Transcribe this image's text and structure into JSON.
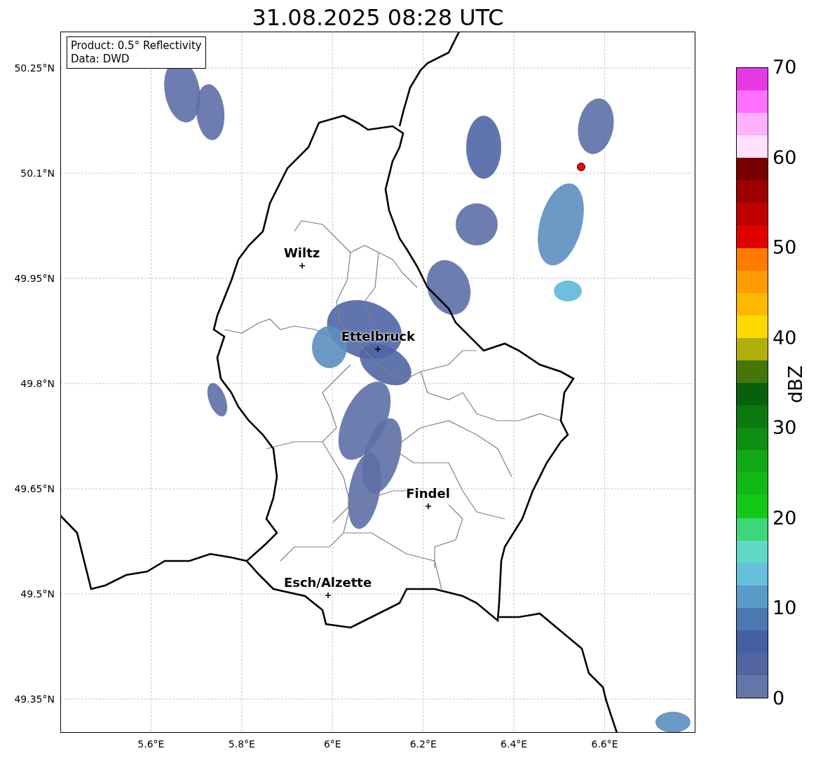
{
  "title": "31.08.2025 08:28 UTC",
  "info_box": [
    "Product: 0.5° Reflectivity",
    "Data: DWD"
  ],
  "map": {
    "lat_ticks": [
      "50.25°N",
      "50.1°N",
      "49.95°N",
      "49.8°N",
      "49.65°N",
      "49.5°N",
      "49.35°N"
    ],
    "lon_ticks": [
      "5.6°E",
      "5.8°E",
      "6°E",
      "6.2°E",
      "6.4°E",
      "6.6°E"
    ],
    "cities": [
      "Wiltz",
      "Ettelbruck",
      "Findel",
      "Esch/Alzette"
    ],
    "radar_site": {
      "color": "#ff0000"
    }
  },
  "colorbar": {
    "label": "dBZ",
    "ticks": [
      "70",
      "60",
      "50",
      "40",
      "30",
      "20",
      "10",
      "0"
    ],
    "segments": [
      {
        "color": "#e63ae6"
      },
      {
        "color": "#ff70ff"
      },
      {
        "color": "#ffb0ff"
      },
      {
        "color": "#ffe0ff"
      },
      {
        "color": "#780000"
      },
      {
        "color": "#9c0000"
      },
      {
        "color": "#c00000"
      },
      {
        "color": "#e00000"
      },
      {
        "color": "#ff7c00"
      },
      {
        "color": "#ff9c00"
      },
      {
        "color": "#ffb800"
      },
      {
        "color": "#ffd800"
      },
      {
        "color": "#b0b00c"
      },
      {
        "color": "#45760a"
      },
      {
        "color": "#08600c"
      },
      {
        "color": "#0c7810"
      },
      {
        "color": "#0e8e12"
      },
      {
        "color": "#10a814"
      },
      {
        "color": "#12b818"
      },
      {
        "color": "#14c818"
      },
      {
        "color": "#3dd678"
      },
      {
        "color": "#5fd8c8"
      },
      {
        "color": "#66c0dc"
      },
      {
        "color": "#5a9cc8"
      },
      {
        "color": "#4a78b0"
      },
      {
        "color": "#4560a2"
      },
      {
        "color": "#5365a0"
      },
      {
        "color": "#6575a8"
      }
    ]
  }
}
